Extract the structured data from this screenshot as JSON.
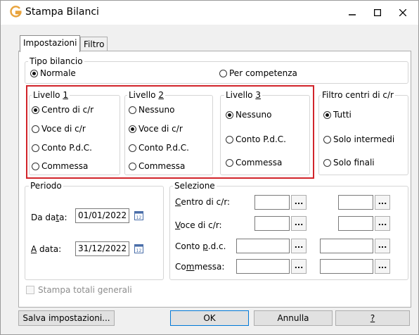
{
  "window": {
    "title": "Stampa Bilanci"
  },
  "tabs": [
    {
      "label": "Impostazioni"
    },
    {
      "label": "Filtro"
    }
  ],
  "tipo_bilancio": {
    "legend": "Tipo bilancio",
    "options": [
      {
        "label": "Normale",
        "checked": true
      },
      {
        "label": "Per competenza",
        "checked": false
      }
    ]
  },
  "livello1": {
    "legend_pre": "Livello ",
    "legend_key": "1",
    "options": [
      {
        "label": "Centro di c/r",
        "checked": true
      },
      {
        "label": "Voce di c/r",
        "checked": false
      },
      {
        "label": "Conto P.d.C.",
        "checked": false
      },
      {
        "label": "Commessa",
        "checked": false
      }
    ]
  },
  "livello2": {
    "legend_pre": "Livello ",
    "legend_key": "2",
    "options": [
      {
        "label": "Nessuno",
        "checked": false
      },
      {
        "label": "Voce di c/r",
        "checked": true
      },
      {
        "label": "Conto P.d.C.",
        "checked": false
      },
      {
        "label": "Commessa",
        "checked": false
      }
    ]
  },
  "livello3": {
    "legend_pre": "Livello ",
    "legend_key": "3",
    "options": [
      {
        "label": "Nessuno",
        "checked": true
      },
      {
        "label": "Conto P.d.C.",
        "checked": false
      },
      {
        "label": "Commessa",
        "checked": false
      }
    ]
  },
  "filtro_centri": {
    "legend": "Filtro centri di c/r",
    "options": [
      {
        "label": "Tutti",
        "checked": true
      },
      {
        "label": "Solo intermedi",
        "checked": false
      },
      {
        "label": "Solo finali",
        "checked": false
      }
    ]
  },
  "periodo": {
    "legend": "Periodo",
    "da_label_pre": "Da da",
    "da_label_key": "t",
    "da_label_post": "a:",
    "da_value": "01/01/2022",
    "a_label_key": "A",
    "a_label_post": " data:",
    "a_value": "31/12/2022"
  },
  "selezione": {
    "legend": "Selezione",
    "centro": {
      "key": "C",
      "rest": "entro di c/r:"
    },
    "voce": {
      "key": "V",
      "rest": "oce di c/r:"
    },
    "conto": {
      "pre": "Conto ",
      "key": "p",
      "rest": ".d.c."
    },
    "commessa": {
      "pre": "Co",
      "key": "m",
      "rest": "messa:"
    },
    "ellipsis": "..."
  },
  "stampa_totali": {
    "label": "Stampa totali generali",
    "checked": false
  },
  "buttons": {
    "salva": "Salva impostazioni...",
    "ok": "OK",
    "annulla": "Annulla",
    "help": "?"
  },
  "colors": {
    "highlight": "#d1242a",
    "app_icon": "#e8a33c"
  }
}
